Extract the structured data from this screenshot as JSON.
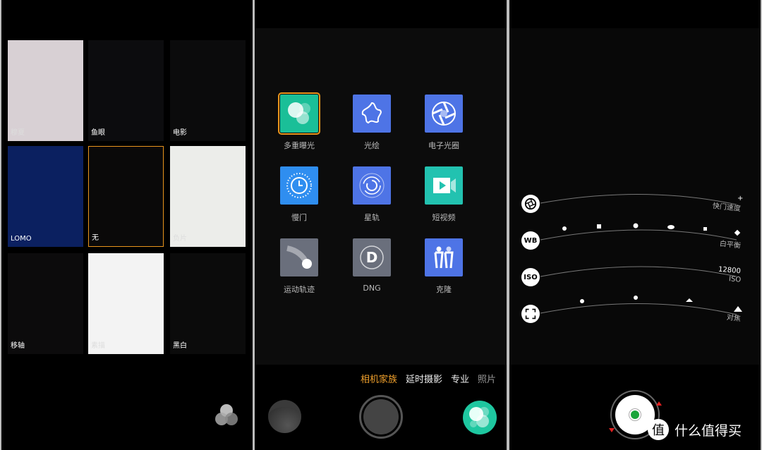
{
  "filters": {
    "items": [
      {
        "label": "穆夏",
        "bg": "#d8d0d4"
      },
      {
        "label": "鱼眼",
        "bg": "#0c0c0e"
      },
      {
        "label": "电影",
        "bg": "#0b0b0c"
      },
      {
        "label": "LOMO",
        "bg": "#0b2060"
      },
      {
        "label": "无",
        "bg": "#0a0909",
        "selected": true
      },
      {
        "label": "负片",
        "bg": "#ecedea"
      },
      {
        "label": "移轴",
        "bg": "#0c0b0c"
      },
      {
        "label": "素描",
        "bg": "#f3f3f3"
      },
      {
        "label": "黑白",
        "bg": "#0b0b0b"
      }
    ],
    "icon": "filters-icon"
  },
  "camera_family": {
    "modes": [
      {
        "label": "多重曝光",
        "icon": "multi-exposure-icon",
        "color": "#1abf98",
        "selected": true
      },
      {
        "label": "光绘",
        "icon": "light-painting-icon",
        "color": "#4e74e6"
      },
      {
        "label": "电子光圈",
        "icon": "aperture-icon",
        "color": "#4e74e6"
      },
      {
        "label": "慢门",
        "icon": "slow-shutter-icon",
        "color": "#2f8ef0"
      },
      {
        "label": "星轨",
        "icon": "star-trail-icon",
        "color": "#4e74e6"
      },
      {
        "label": "短视频",
        "icon": "short-video-icon",
        "color": "#22c2b0"
      },
      {
        "label": "运动轨迹",
        "icon": "motion-trail-icon",
        "color": "#6a6f7c"
      },
      {
        "label": "DNG",
        "icon": "dng-icon",
        "color": "#6a6f7c"
      },
      {
        "label": "克隆",
        "icon": "clone-icon",
        "color": "#4e74e6"
      }
    ],
    "tabs": [
      {
        "label": "相机家族",
        "active": true
      },
      {
        "label": "延时摄影"
      },
      {
        "label": "专业"
      },
      {
        "label": "照片"
      }
    ],
    "accent": "#f0a02c"
  },
  "pro": {
    "shutter": {
      "label": "快门速度",
      "icon": "aperture-icon",
      "mark": "+"
    },
    "wb": {
      "label": "白平衡",
      "button": "WB",
      "icons": [
        "bulb-icon",
        "fluorescent-icon",
        "sun-icon",
        "cloud-icon",
        "shade-icon",
        "flash-icon"
      ]
    },
    "iso": {
      "label": "ISO",
      "button": "ISO",
      "value": "12800"
    },
    "focus": {
      "label": "对焦",
      "icons": [
        "macro-flower-icon",
        "person-icon",
        "house-icon",
        "mountain-icon"
      ]
    }
  },
  "watermark": {
    "badge": "值",
    "text": "什么值得买"
  }
}
